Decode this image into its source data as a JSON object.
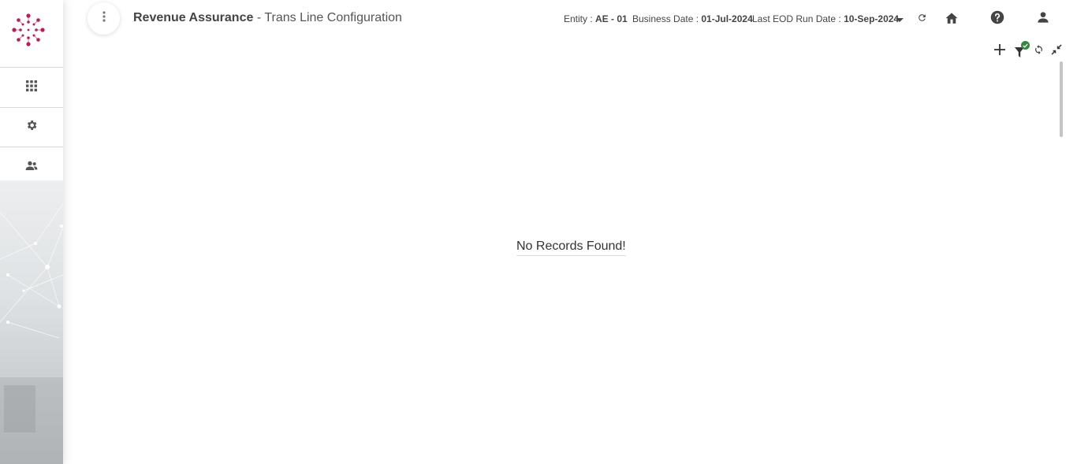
{
  "header": {
    "module": "Revenue Assurance",
    "separator": " - ",
    "page": "Trans Line Configuration",
    "entity_label": "Entity : ",
    "entity_value": "AE - 01",
    "business_date_label": "Business Date : ",
    "business_date_value": "01-Jul-2024",
    "eod_label": "Last EOD Run Date : ",
    "eod_value": "10-Sep-2024"
  },
  "sidebar": {
    "items": [
      {
        "icon": "apps-grid-icon"
      },
      {
        "icon": "gear-icon"
      },
      {
        "icon": "user-group-icon"
      }
    ]
  },
  "header_icons": [
    "more-vert-icon",
    "chevron-down-icon",
    "refresh-icon",
    "home-icon",
    "help-icon",
    "user-icon"
  ],
  "toolbar_icons": [
    "add-icon",
    "filter-icon",
    "sync-icon",
    "collapse-icon"
  ],
  "main": {
    "empty_message": "No Records Found!"
  },
  "colors": {
    "brand": "#c2185b",
    "filter_badge": "#2e8b3a",
    "icon": "#555555"
  }
}
